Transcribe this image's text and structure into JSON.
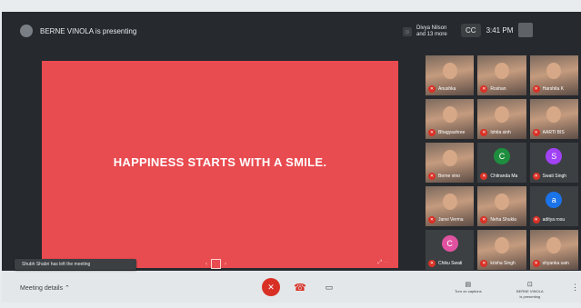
{
  "presenter": {
    "text": "BERNE VINOLA is presenting"
  },
  "participants_info": {
    "line1": "Divya Nilson",
    "line2": "and 13 more"
  },
  "status": {
    "cc": "CC",
    "time": "3:41 PM"
  },
  "slide": {
    "headline": "HAPPINESS STARTS WITH A SMILE.",
    "pager_prev": "‹",
    "pager_next": "›",
    "fullscreen": "⤢ ⋯"
  },
  "toast": {
    "text": "Shubh Shabri has left the meeting"
  },
  "tiles": [
    {
      "name": "Anushka",
      "type": "photo"
    },
    {
      "name": "Roshan",
      "type": "photo"
    },
    {
      "name": "Harshita K",
      "type": "photo"
    },
    {
      "name": "Bhagyashree",
      "type": "photo"
    },
    {
      "name": "Ishita sinh",
      "type": "photo"
    },
    {
      "name": "AARTI BIS",
      "type": "photo"
    },
    {
      "name": "Berne vino",
      "type": "photo"
    },
    {
      "name": "Chitranda Ma",
      "type": "letter",
      "letter": "C",
      "color": "#1e8e3e"
    },
    {
      "name": "Swati Singh",
      "type": "letter",
      "letter": "S",
      "color": "#a142f4"
    },
    {
      "name": "Janvi Verma",
      "type": "photo"
    },
    {
      "name": "Neha Shukla",
      "type": "photo"
    },
    {
      "name": "aditya rosu",
      "type": "letter",
      "letter": "a",
      "color": "#1a73e8"
    },
    {
      "name": "Chiku Swati",
      "type": "letter",
      "letter": "C",
      "color": "#e052a0"
    },
    {
      "name": "krisha Singh",
      "type": "photo"
    },
    {
      "name": "shyanka sain",
      "type": "photo"
    }
  ],
  "bottom": {
    "meeting_details": "Meeting details",
    "captions_label": "Turn on captions",
    "presenting_name": "BERNE VINOLA",
    "presenting_sub": "is presenting"
  },
  "icons": {
    "mic_off": "mic-off-icon",
    "hangup": "hangup-icon",
    "camera": "camera-icon"
  },
  "colors": {
    "slide_bg": "#e84b50",
    "danger": "#d93025",
    "dark_bg": "#26292d"
  }
}
